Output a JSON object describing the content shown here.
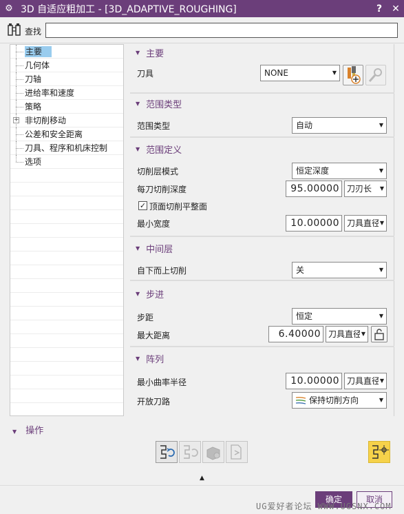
{
  "window": {
    "title": "3D 自适应粗加工 - [3D_ADAPTIVE_ROUGHING]",
    "help": "?",
    "close": "✕"
  },
  "search": {
    "label": "查找",
    "value": ""
  },
  "tree": {
    "items": [
      {
        "label": "主要",
        "selected": true
      },
      {
        "label": "几何体"
      },
      {
        "label": "刀轴"
      },
      {
        "label": "进给率和速度"
      },
      {
        "label": "策略"
      },
      {
        "label": "非切削移动",
        "expandable": true
      },
      {
        "label": "公差和安全距离"
      },
      {
        "label": "刀具、程序和机床控制"
      },
      {
        "label": "选项"
      }
    ]
  },
  "main": {
    "header": "主要",
    "tool_label": "刀具",
    "tool_value": "NONE"
  },
  "range_type": {
    "header": "范围类型",
    "label": "范围类型",
    "value": "自动"
  },
  "range_def": {
    "header": "范围定义",
    "cut_mode_label": "切削层模式",
    "cut_mode_value": "恒定深度",
    "depth_label": "每刀切削深度",
    "depth_value": "95.00000",
    "depth_unit": "刀刃长",
    "top_face_label": "顶面切削平整面",
    "top_face_checked": true,
    "min_width_label": "最小宽度",
    "min_width_value": "10.00000",
    "min_width_unit": "刀具直径"
  },
  "middle": {
    "header": "中间层",
    "label": "自下而上切削",
    "value": "关"
  },
  "stepover": {
    "header": "步进",
    "step_label": "步距",
    "step_value": "恒定",
    "max_label": "最大距离",
    "max_value": "6.40000",
    "max_unit": "刀具直径"
  },
  "pattern": {
    "header": "阵列",
    "radius_label": "最小曲率半径",
    "radius_value": "10.00000",
    "radius_unit": "刀具直径",
    "open_label": "开放刀路",
    "open_value": "保持切削方向"
  },
  "ops": {
    "header": "操作"
  },
  "buttons": {
    "ok": "确定",
    "cancel": "取消"
  },
  "watermark": "UG爱好者论坛 WWW.UGSNX.COM",
  "colors": {
    "accent": "#6b3e7a",
    "selected": "#99ccee"
  }
}
